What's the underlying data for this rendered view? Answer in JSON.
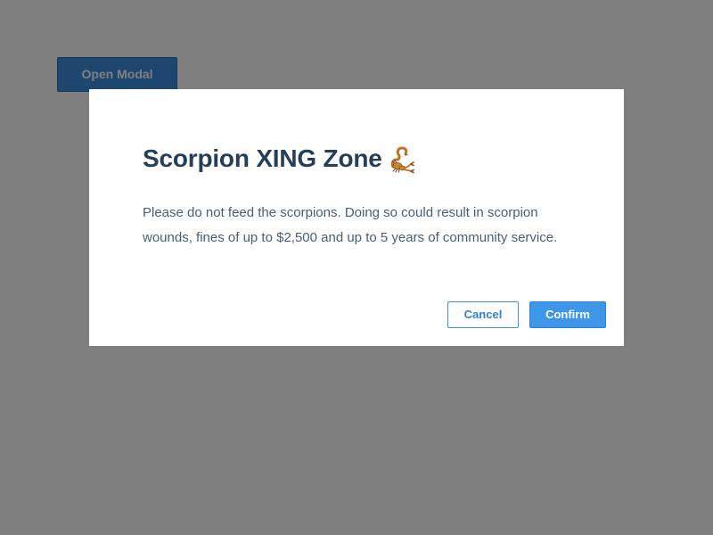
{
  "page": {
    "open_modal_label": "Open Modal"
  },
  "modal": {
    "title": "Scorpion XING Zone",
    "title_icon": "scorpion-icon",
    "body": "Please do not feed the scorpions. Doing so could result in scorpion wounds, fines of up to $2,500 and up to 5 years of community service.",
    "cancel_label": "Cancel",
    "confirm_label": "Confirm"
  },
  "colors": {
    "overlay": "rgba(0,0,0,0.5)",
    "title": "#253f5b",
    "body_text": "#4a5e73",
    "accent": "#3d96e8",
    "modal_background": "#ffffff"
  }
}
